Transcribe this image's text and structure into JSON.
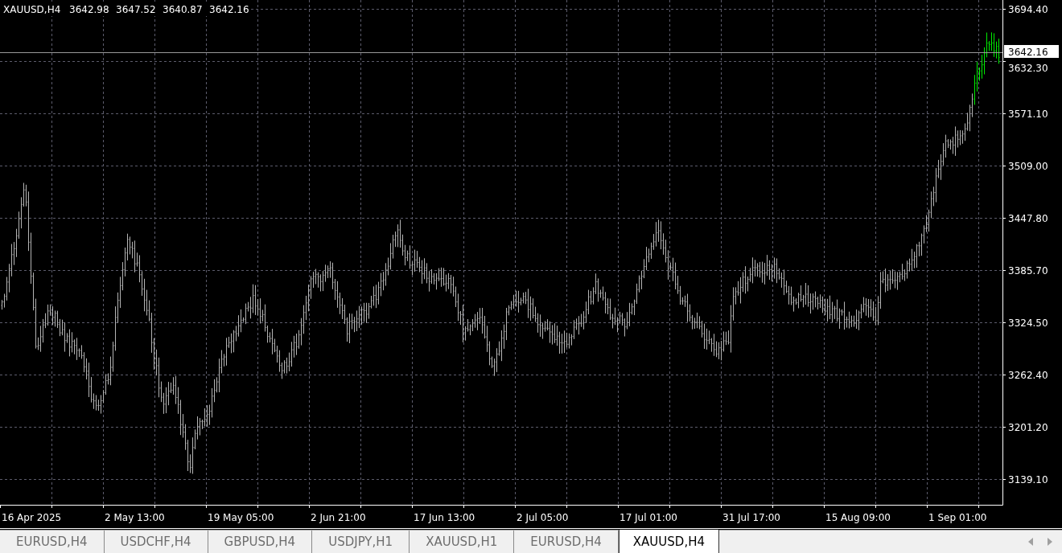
{
  "chart": {
    "header": {
      "symbol": "XAUUSD,H4",
      "values": [
        "3642.98",
        "3647.52",
        "3640.87",
        "3642.16"
      ]
    },
    "current_price": "3642.16",
    "price_axis": [
      "3694.40",
      "3632.30",
      "3571.10",
      "3509.00",
      "3447.80",
      "3385.70",
      "3324.50",
      "3262.40",
      "3201.20",
      "3139.10"
    ],
    "time_axis": [
      "16 Apr 2025",
      "2 May 13:00",
      "19 May 05:00",
      "2 Jun 21:00",
      "17 Jun 13:00",
      "2 Jul 05:00",
      "17 Jul 01:00",
      "31 Jul 17:00",
      "15 Aug 09:00",
      "1 Sep 01:00"
    ]
  },
  "tabs": [
    {
      "label": "EURUSD,H4",
      "selected": false
    },
    {
      "label": "USDCHF,H4",
      "selected": false
    },
    {
      "label": "GBPUSD,H4",
      "selected": false
    },
    {
      "label": "USDJPY,H1",
      "selected": false
    },
    {
      "label": "XAUUSD,H1",
      "selected": false
    },
    {
      "label": "EURUSD,H4",
      "selected": false
    },
    {
      "label": "XAUUSD,H4",
      "selected": true
    }
  ]
}
